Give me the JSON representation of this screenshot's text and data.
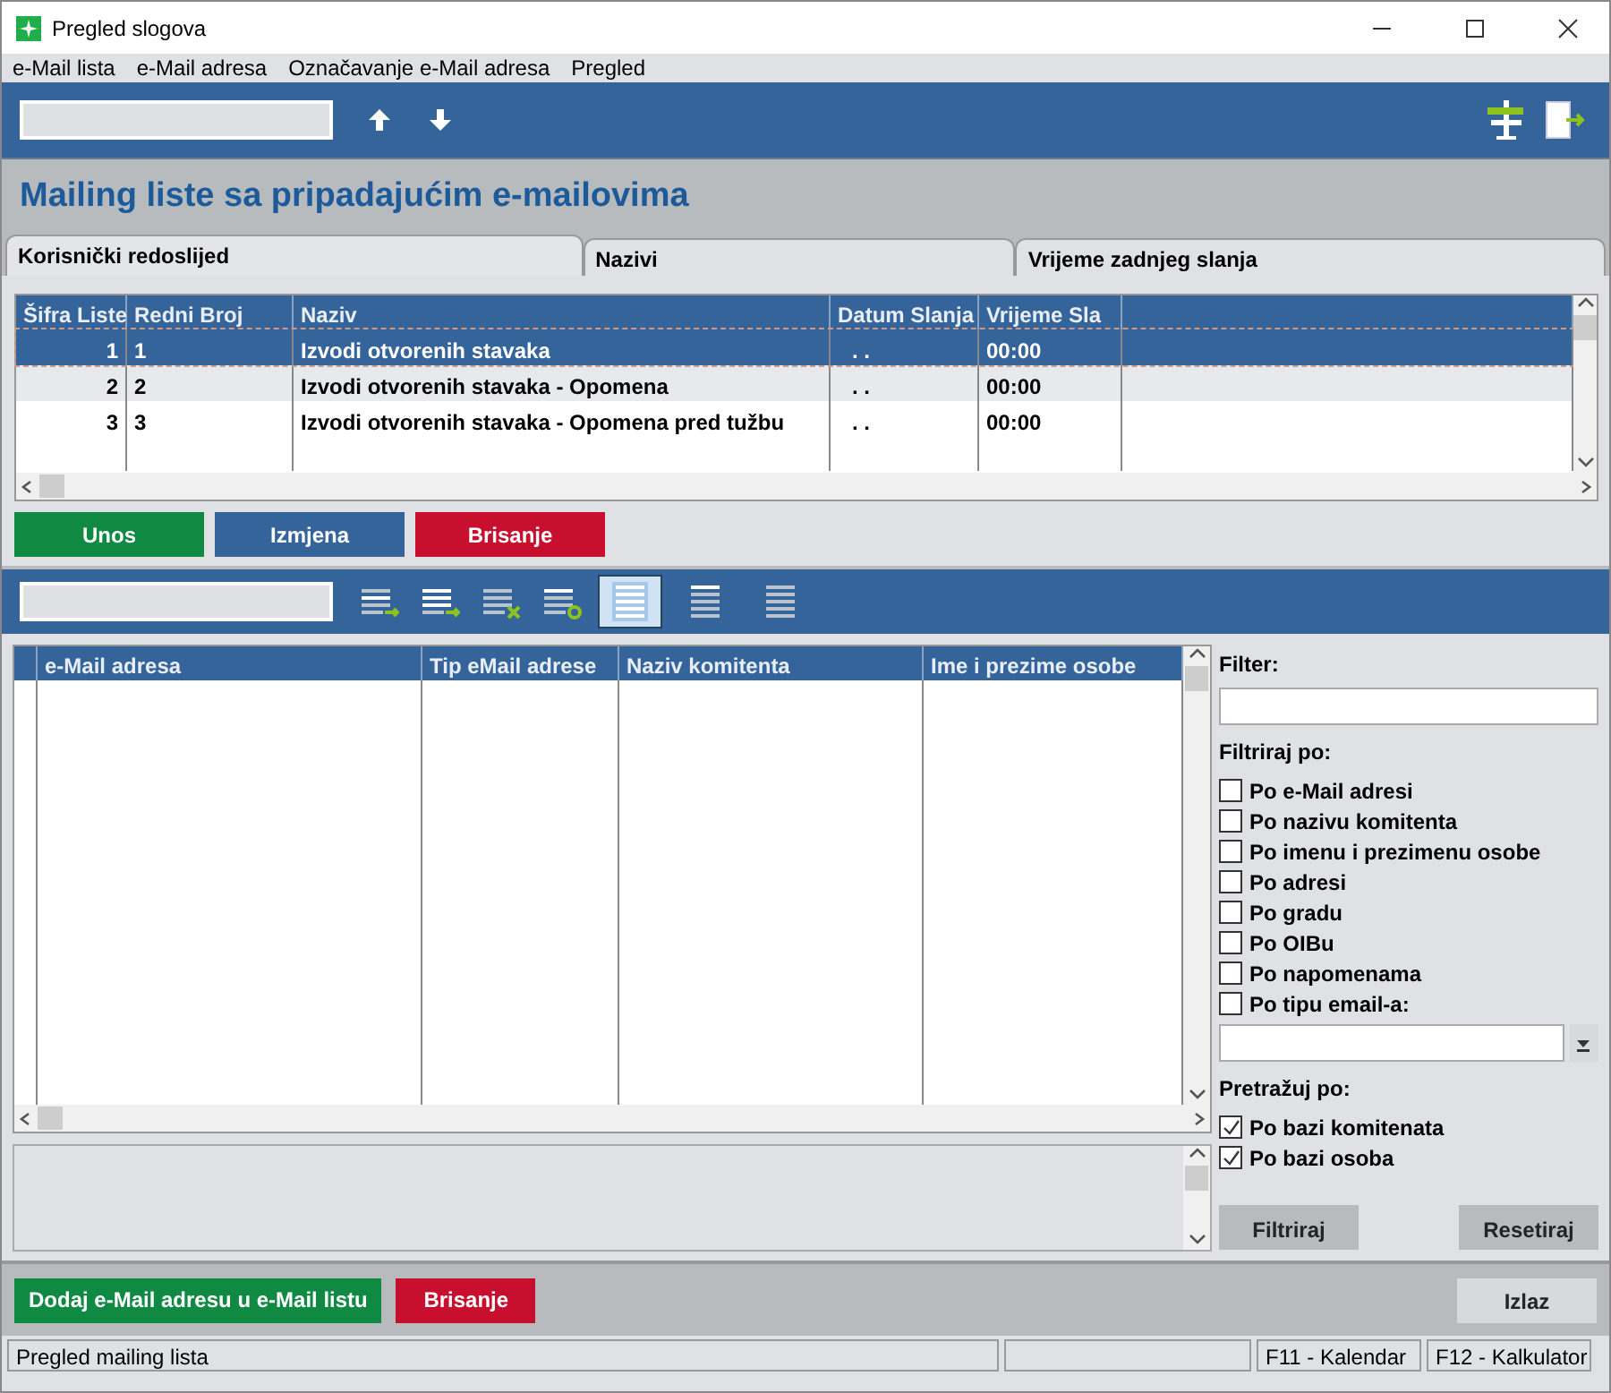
{
  "window": {
    "title": "Pregled slogova"
  },
  "menu": [
    "e-Mail lista",
    "e-Mail adresa",
    "Označavanje e-Mail adresa",
    "Pregled"
  ],
  "heading": "Mailing liste sa pripadajućim e-mailovima",
  "tabs": [
    {
      "label": "Korisnički redoslijed",
      "selected": true
    },
    {
      "label": "Nazivi",
      "selected": false
    },
    {
      "label": "Vrijeme zadnjeg slanja",
      "selected": false
    }
  ],
  "list_table": {
    "columns": [
      "Šifra Liste",
      "Redni Broj",
      "Naziv",
      "Datum Slanja",
      "Vrijeme Sla"
    ],
    "rows": [
      {
        "cells": [
          "1",
          "1",
          "Izvodi otvorenih stavaka",
          ". .",
          "00:00"
        ],
        "selected": true
      },
      {
        "cells": [
          "2",
          "2",
          "Izvodi otvorenih stavaka - Opomena",
          ". .",
          "00:00"
        ],
        "selected": false
      },
      {
        "cells": [
          "3",
          "3",
          "Izvodi otvorenih stavaka - Opomena pred tužbu",
          ". .",
          "00:00"
        ],
        "selected": false
      }
    ]
  },
  "list_buttons": [
    {
      "label": "Unos",
      "color": "#108a43"
    },
    {
      "label": "Izmjena",
      "color": "#35649b"
    },
    {
      "label": "Brisanje",
      "color": "#c8102e"
    }
  ],
  "view_modes": [
    {
      "selected": true
    },
    {
      "selected": false
    },
    {
      "selected": false
    }
  ],
  "email_table": {
    "columns": [
      "e-Mail adresa",
      "Tip eMail adrese",
      "Naziv komitenta",
      "Ime i prezime osobe"
    ]
  },
  "filter": {
    "label": "Filter:",
    "filter_by_label": "Filtriraj po:",
    "filter_by": [
      {
        "label": "Po e-Mail adresi",
        "checked": false
      },
      {
        "label": "Po nazivu komitenta",
        "checked": false
      },
      {
        "label": "Po imenu i prezimenu osobe",
        "checked": false
      },
      {
        "label": "Po adresi",
        "checked": false
      },
      {
        "label": "Po gradu",
        "checked": false
      },
      {
        "label": "Po OIBu",
        "checked": false
      },
      {
        "label": "Po napomenama",
        "checked": false
      },
      {
        "label": "Po tipu email-a:",
        "checked": false
      }
    ],
    "search_by_label": "Pretražuj po:",
    "search_by": [
      {
        "label": "Po bazi komitenata",
        "checked": true
      },
      {
        "label": "Po bazi osoba",
        "checked": true
      }
    ],
    "buttons": [
      "Filtriraj",
      "Resetiraj"
    ]
  },
  "bottom_buttons": [
    {
      "label": "Dodaj e-Mail adresu u e-Mail listu",
      "color": "#108a43"
    },
    {
      "label": "Brisanje",
      "color": "#c8102e"
    }
  ],
  "exit_button": "Izlaz",
  "status_bar": [
    "Pregled mailing lista",
    "F11 - Kalendar",
    "F12 - Kalkulator"
  ]
}
